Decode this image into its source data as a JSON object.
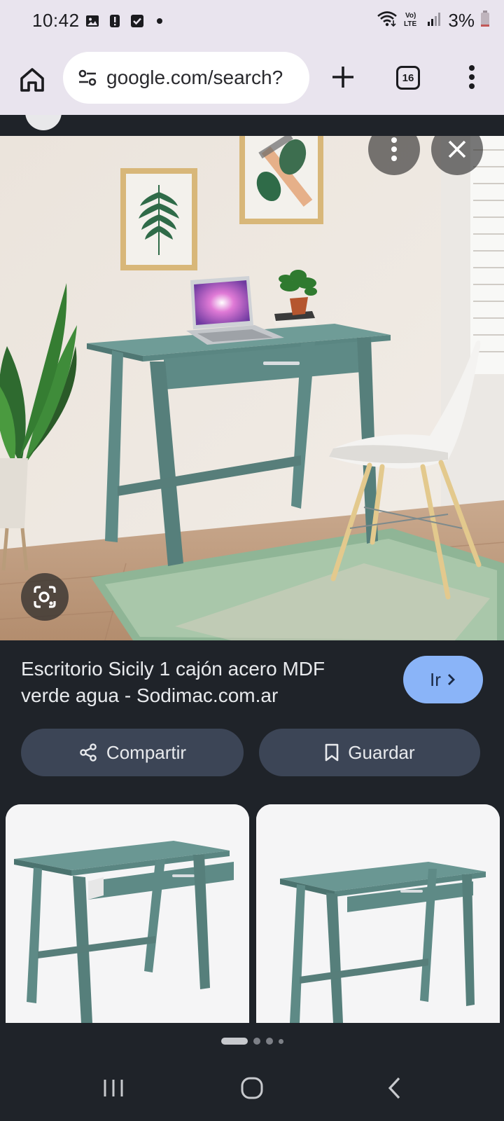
{
  "status_bar": {
    "time": "10:42",
    "battery": "3%",
    "icons": [
      "image-icon",
      "alert-icon",
      "check-icon",
      "dot-icon",
      "wifi-icon",
      "volte-icon",
      "signal-icon",
      "battery-icon"
    ]
  },
  "toolbar": {
    "url": "google.com/search?",
    "tab_count": "16"
  },
  "result": {
    "title": "Escritorio Sicily 1 cajón acero MDF verde agua - Sodimac.com.ar",
    "go_label": "Ir"
  },
  "actions": {
    "share_label": "Compartir",
    "save_label": "Guardar"
  },
  "carousel": {
    "active_index": 0,
    "count": 4
  },
  "colors": {
    "accent": "#8ab4f8",
    "desk": "#5e8a86",
    "background": "#1f2329",
    "chrome": "#e9e4ee"
  }
}
